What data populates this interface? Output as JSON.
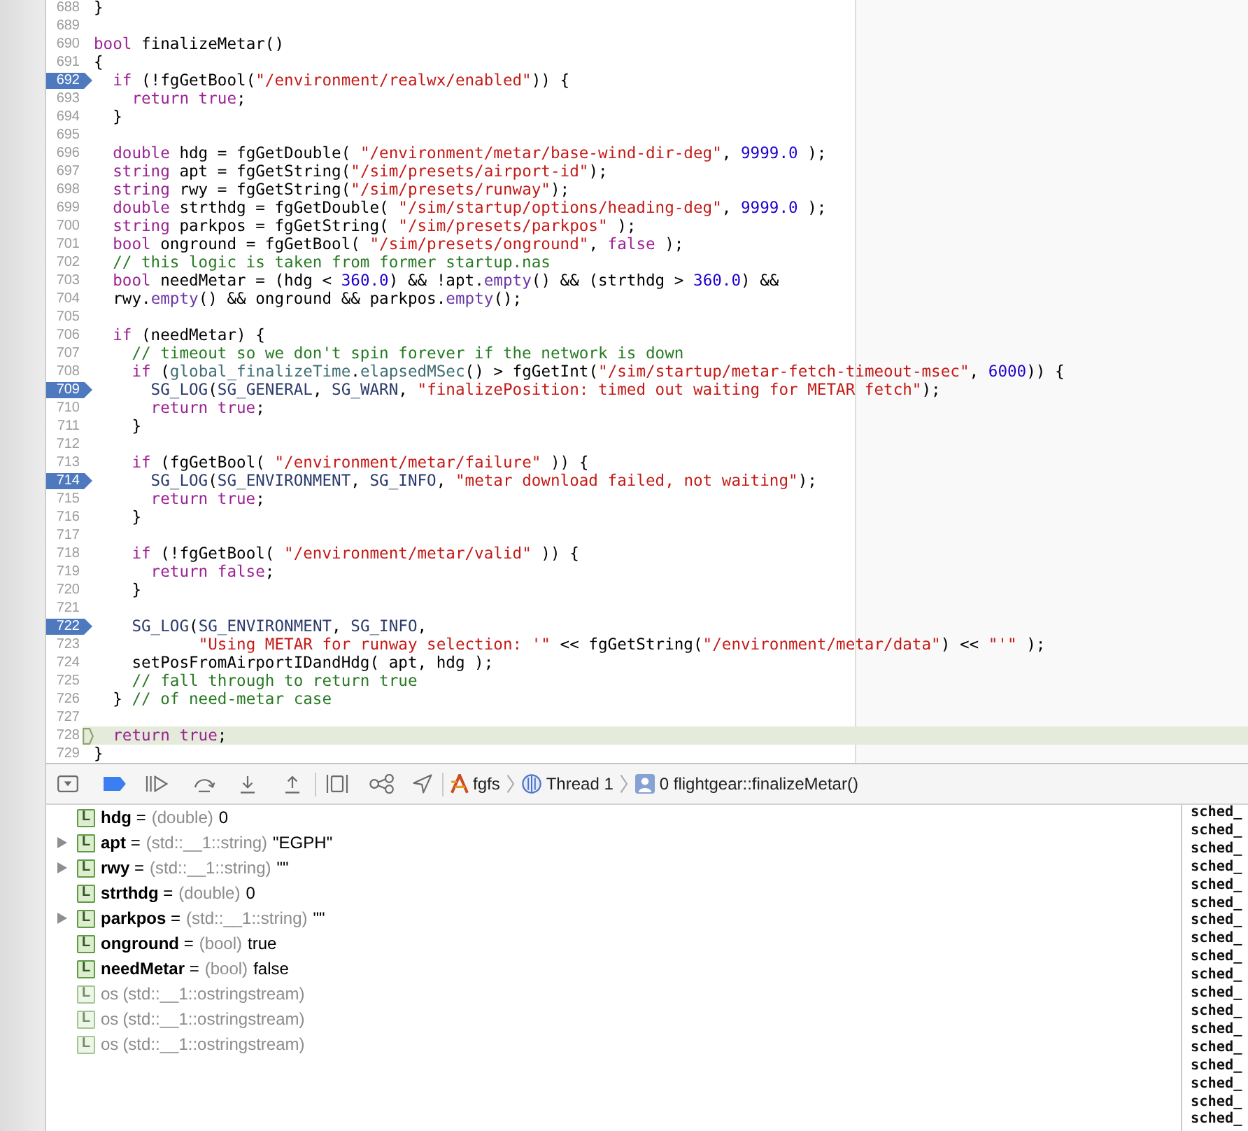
{
  "editor": {
    "lines": [
      {
        "number": "688",
        "kind": "code",
        "breakpoint": false,
        "current": false,
        "tokens": [
          {
            "kind": "plain",
            "text": "}"
          }
        ]
      },
      {
        "number": "689",
        "breakpoint": false,
        "current": false
      },
      {
        "number": "690",
        "kind": "code",
        "breakpoint": false,
        "current": false,
        "tokens": [
          {
            "kind": "keyword",
            "text": "bool"
          },
          {
            "kind": "plain",
            "text": " finalizeMetar()"
          }
        ]
      },
      {
        "number": "691",
        "kind": "code",
        "breakpoint": false,
        "current": false,
        "tokens": [
          {
            "kind": "plain",
            "text": "{"
          }
        ],
        "children": [
          {
            "number": "692",
            "kind": "code",
            "breakpoint": true,
            "current": false,
            "tokens": [
              {
                "kind": "keyword",
                "text": "if"
              },
              {
                "kind": "plain",
                "text": " (!fgGetBool("
              },
              {
                "kind": "string",
                "text": "\"/environment/realwx/enabled\""
              },
              {
                "kind": "plain",
                "text": ")) {"
              }
            ],
            "children": [
              {
                "number": "693",
                "kind": "code",
                "breakpoint": false,
                "current": false,
                "tokens": [
                  {
                    "kind": "keyword",
                    "text": "return true"
                  },
                  {
                    "kind": "plain",
                    "text": ";"
                  }
                ]
              }
            ]
          },
          {
            "number": "694",
            "kind": "code",
            "breakpoint": false,
            "current": false,
            "tokens": [
              {
                "kind": "plain",
                "text": "}"
              }
            ]
          },
          {
            "number": "695",
            "breakpoint": false,
            "current": false
          },
          {
            "number": "696",
            "kind": "code",
            "breakpoint": false,
            "current": false,
            "tokens": [
              {
                "kind": "keyword",
                "text": "double"
              },
              {
                "kind": "plain",
                "text": " hdg = fgGetDouble( "
              },
              {
                "kind": "string",
                "text": "\"/environment/metar/base-wind-dir-deg\""
              },
              {
                "kind": "plain",
                "text": ", "
              },
              {
                "kind": "number",
                "text": "9999.0"
              },
              {
                "kind": "plain",
                "text": " );"
              }
            ]
          },
          {
            "number": "697",
            "kind": "code",
            "breakpoint": false,
            "current": false,
            "tokens": [
              {
                "kind": "keyword",
                "text": "string"
              },
              {
                "kind": "plain",
                "text": " apt = fgGetString("
              },
              {
                "kind": "string",
                "text": "\"/sim/presets/airport-id\""
              },
              {
                "kind": "plain",
                "text": ");"
              }
            ]
          },
          {
            "number": "698",
            "kind": "code",
            "breakpoint": false,
            "current": false,
            "tokens": [
              {
                "kind": "keyword",
                "text": "string"
              },
              {
                "kind": "plain",
                "text": " rwy = fgGetString("
              },
              {
                "kind": "string",
                "text": "\"/sim/presets/runway\""
              },
              {
                "kind": "plain",
                "text": ");"
              }
            ]
          },
          {
            "number": "699",
            "kind": "code",
            "breakpoint": false,
            "current": false,
            "tokens": [
              {
                "kind": "keyword",
                "text": "double"
              },
              {
                "kind": "plain",
                "text": " strthdg = fgGetDouble( "
              },
              {
                "kind": "string",
                "text": "\"/sim/startup/options/heading-deg\""
              },
              {
                "kind": "plain",
                "text": ", "
              },
              {
                "kind": "number",
                "text": "9999.0"
              },
              {
                "kind": "plain",
                "text": " );"
              }
            ]
          },
          {
            "number": "700",
            "kind": "code",
            "breakpoint": false,
            "current": false,
            "tokens": [
              {
                "kind": "keyword",
                "text": "string"
              },
              {
                "kind": "plain",
                "text": " parkpos = fgGetString( "
              },
              {
                "kind": "string",
                "text": "\"/sim/presets/parkpos\""
              },
              {
                "kind": "plain",
                "text": " );"
              }
            ]
          },
          {
            "number": "701",
            "kind": "code",
            "breakpoint": false,
            "current": false,
            "tokens": [
              {
                "kind": "keyword",
                "text": "bool"
              },
              {
                "kind": "plain",
                "text": " onground = fgGetBool( "
              },
              {
                "kind": "string",
                "text": "\"/sim/presets/onground\""
              },
              {
                "kind": "plain",
                "text": ", "
              },
              {
                "kind": "keyword",
                "text": "false"
              },
              {
                "kind": "plain",
                "text": " );"
              }
            ]
          },
          {
            "number": "702",
            "kind": "code",
            "breakpoint": false,
            "current": false,
            "tokens": [
              {
                "kind": "comment",
                "text": "// this logic is taken from former startup.nas"
              }
            ]
          },
          {
            "number": "703",
            "kind": "code",
            "breakpoint": false,
            "current": false,
            "tokens": [
              {
                "kind": "keyword",
                "text": "bool"
              },
              {
                "kind": "plain",
                "text": " needMetar = (hdg < "
              },
              {
                "kind": "number",
                "text": "360.0"
              },
              {
                "kind": "plain",
                "text": ") && !apt."
              },
              {
                "kind": "method",
                "text": "empty"
              },
              {
                "kind": "plain",
                "text": "() && (strthdg > "
              },
              {
                "kind": "number",
                "text": "360.0"
              },
              {
                "kind": "plain",
                "text": ") &&"
              }
            ]
          },
          {
            "number": "704",
            "kind": "code",
            "breakpoint": false,
            "current": false,
            "tokens": [
              {
                "kind": "plain",
                "text": "rwy."
              },
              {
                "kind": "method",
                "text": "empty"
              },
              {
                "kind": "plain",
                "text": "() && onground && parkpos."
              },
              {
                "kind": "method",
                "text": "empty"
              },
              {
                "kind": "plain",
                "text": "();"
              }
            ]
          },
          {
            "number": "705",
            "breakpoint": false,
            "current": false
          },
          {
            "number": "706",
            "kind": "code",
            "breakpoint": false,
            "current": false,
            "tokens": [
              {
                "kind": "keyword",
                "text": "if"
              },
              {
                "kind": "plain",
                "text": " (needMetar) {"
              }
            ],
            "children": [
              {
                "number": "707",
                "kind": "code",
                "breakpoint": false,
                "current": false,
                "tokens": [
                  {
                    "kind": "comment",
                    "text": "// timeout so we don't spin forever if the network is down"
                  }
                ]
              },
              {
                "number": "708",
                "kind": "code",
                "breakpoint": false,
                "current": false,
                "tokens": [
                  {
                    "kind": "keyword",
                    "text": "if"
                  },
                  {
                    "kind": "plain",
                    "text": " ("
                  },
                  {
                    "kind": "member",
                    "text": "global_finalizeTime"
                  },
                  {
                    "kind": "plain",
                    "text": "."
                  },
                  {
                    "kind": "member",
                    "text": "elapsedMSec"
                  },
                  {
                    "kind": "plain",
                    "text": "() > fgGetInt("
                  },
                  {
                    "kind": "string",
                    "text": "\"/sim/startup/metar-fetch-timeout-msec\""
                  },
                  {
                    "kind": "plain",
                    "text": ", "
                  },
                  {
                    "kind": "number",
                    "text": "6000"
                  },
                  {
                    "kind": "plain",
                    "text": ")) {"
                  }
                ],
                "children": [
                  {
                    "number": "709",
                    "kind": "code",
                    "breakpoint": true,
                    "current": false,
                    "tokens": [
                      {
                        "kind": "macro",
                        "text": "SG_LOG"
                      },
                      {
                        "kind": "plain",
                        "text": "("
                      },
                      {
                        "kind": "macro",
                        "text": "SG_GENERAL"
                      },
                      {
                        "kind": "plain",
                        "text": ", "
                      },
                      {
                        "kind": "macro",
                        "text": "SG_WARN"
                      },
                      {
                        "kind": "plain",
                        "text": ", "
                      },
                      {
                        "kind": "string",
                        "text": "\"finalizePosition: timed out waiting for METAR fetch\""
                      },
                      {
                        "kind": "plain",
                        "text": ");"
                      }
                    ]
                  },
                  {
                    "number": "710",
                    "kind": "code",
                    "breakpoint": false,
                    "current": false,
                    "tokens": [
                      {
                        "kind": "keyword",
                        "text": "return true"
                      },
                      {
                        "kind": "plain",
                        "text": ";"
                      }
                    ]
                  }
                ]
              },
              {
                "number": "711",
                "kind": "code",
                "breakpoint": false,
                "current": false,
                "tokens": [
                  {
                    "kind": "plain",
                    "text": "}"
                  }
                ]
              },
              {
                "number": "712",
                "breakpoint": false,
                "current": false
              },
              {
                "number": "713",
                "kind": "code",
                "breakpoint": false,
                "current": false,
                "tokens": [
                  {
                    "kind": "keyword",
                    "text": "if"
                  },
                  {
                    "kind": "plain",
                    "text": " (fgGetBool( "
                  },
                  {
                    "kind": "string",
                    "text": "\"/environment/metar/failure\""
                  },
                  {
                    "kind": "plain",
                    "text": " )) {"
                  }
                ],
                "children": [
                  {
                    "number": "714",
                    "kind": "code",
                    "breakpoint": true,
                    "current": false,
                    "tokens": [
                      {
                        "kind": "macro",
                        "text": "SG_LOG"
                      },
                      {
                        "kind": "plain",
                        "text": "("
                      },
                      {
                        "kind": "macro",
                        "text": "SG_ENVIRONMENT"
                      },
                      {
                        "kind": "plain",
                        "text": ", "
                      },
                      {
                        "kind": "macro",
                        "text": "SG_INFO"
                      },
                      {
                        "kind": "plain",
                        "text": ", "
                      },
                      {
                        "kind": "string",
                        "text": "\"metar download failed, not waiting\""
                      },
                      {
                        "kind": "plain",
                        "text": ");"
                      }
                    ]
                  },
                  {
                    "number": "715",
                    "kind": "code",
                    "breakpoint": false,
                    "current": false,
                    "tokens": [
                      {
                        "kind": "keyword",
                        "text": "return true"
                      },
                      {
                        "kind": "plain",
                        "text": ";"
                      }
                    ]
                  }
                ]
              },
              {
                "number": "716",
                "kind": "code",
                "breakpoint": false,
                "current": false,
                "tokens": [
                  {
                    "kind": "plain",
                    "text": "}"
                  }
                ]
              },
              {
                "number": "717",
                "breakpoint": false,
                "current": false
              },
              {
                "number": "718",
                "kind": "code",
                "breakpoint": false,
                "current": false,
                "tokens": [
                  {
                    "kind": "keyword",
                    "text": "if"
                  },
                  {
                    "kind": "plain",
                    "text": " (!fgGetBool( "
                  },
                  {
                    "kind": "string",
                    "text": "\"/environment/metar/valid\""
                  },
                  {
                    "kind": "plain",
                    "text": " )) {"
                  }
                ],
                "children": [
                  {
                    "number": "719",
                    "kind": "code",
                    "breakpoint": false,
                    "current": false,
                    "tokens": [
                      {
                        "kind": "keyword",
                        "text": "return false"
                      },
                      {
                        "kind": "plain",
                        "text": ";"
                      }
                    ]
                  }
                ]
              },
              {
                "number": "720",
                "kind": "code",
                "breakpoint": false,
                "current": false,
                "tokens": [
                  {
                    "kind": "plain",
                    "text": "}"
                  }
                ]
              },
              {
                "number": "721",
                "breakpoint": false,
                "current": false
              },
              {
                "number": "722",
                "kind": "code",
                "breakpoint": true,
                "current": false,
                "tokens": [
                  {
                    "kind": "macro",
                    "text": "SG_LOG"
                  },
                  {
                    "kind": "plain",
                    "text": "("
                  },
                  {
                    "kind": "macro",
                    "text": "SG_ENVIRONMENT"
                  },
                  {
                    "kind": "plain",
                    "text": ", "
                  },
                  {
                    "kind": "macro",
                    "text": "SG_INFO"
                  },
                  {
                    "kind": "plain",
                    "text": ","
                  }
                ],
                "children": [
                  {
                    "number": "723",
                    "kind": "continuation",
                    "breakpoint": false,
                    "current": false,
                    "tokens": [
                      {
                        "kind": "string",
                        "text": "\"Using METAR for runway selection: '\""
                      },
                      {
                        "kind": "plain",
                        "text": " << fgGetString("
                      },
                      {
                        "kind": "string",
                        "text": "\"/environment/metar/data\""
                      },
                      {
                        "kind": "plain",
                        "text": ") << "
                      },
                      {
                        "kind": "string",
                        "text": "\"'\""
                      },
                      {
                        "kind": "plain",
                        "text": " );"
                      }
                    ]
                  }
                ]
              },
              {
                "number": "724",
                "kind": "code",
                "breakpoint": false,
                "current": false,
                "tokens": [
                  {
                    "kind": "plain",
                    "text": "setPosFromAirportIDandHdg( apt, hdg );"
                  }
                ]
              },
              {
                "number": "725",
                "kind": "code",
                "breakpoint": false,
                "current": false,
                "tokens": [
                  {
                    "kind": "comment",
                    "text": "// fall through to return true"
                  }
                ]
              }
            ]
          },
          {
            "number": "726",
            "kind": "code",
            "breakpoint": false,
            "current": false,
            "tokens": [
              {
                "kind": "plain",
                "text": "} "
              },
              {
                "kind": "comment",
                "text": "// of need-metar case"
              }
            ]
          },
          {
            "number": "727",
            "breakpoint": false,
            "current": false
          },
          {
            "number": "728",
            "kind": "code",
            "breakpoint": false,
            "current": true,
            "tokens": [
              {
                "kind": "keyword",
                "text": "return true"
              },
              {
                "kind": "plain",
                "text": ";"
              }
            ]
          }
        ]
      },
      {
        "number": "729",
        "kind": "code",
        "breakpoint": false,
        "current": false,
        "tokens": [
          {
            "kind": "plain",
            "text": "}"
          }
        ]
      }
    ]
  },
  "debug_bar": {
    "breakpoints_active": true,
    "breadcrumbs": [
      {
        "kind": "process",
        "label": "fgfs"
      },
      {
        "kind": "thread",
        "label": "Thread 1"
      },
      {
        "kind": "frame",
        "label": "0 flightgear::finalizeMetar()"
      }
    ]
  },
  "variables": [
    {
      "badge": "L",
      "expandable": false,
      "dimmed": false,
      "name": "hdg",
      "separator": "=",
      "type": "(double)",
      "value": "0"
    },
    {
      "badge": "L",
      "expandable": true,
      "dimmed": false,
      "name": "apt",
      "separator": "=",
      "type": "(std::__1::string)",
      "value": "\"EGPH\""
    },
    {
      "badge": "L",
      "expandable": true,
      "dimmed": false,
      "name": "rwy",
      "separator": "=",
      "type": "(std::__1::string)",
      "value": "\"\""
    },
    {
      "badge": "L",
      "expandable": false,
      "dimmed": false,
      "name": "strthdg",
      "separator": "=",
      "type": "(double)",
      "value": "0"
    },
    {
      "badge": "L",
      "expandable": true,
      "dimmed": false,
      "name": "parkpos",
      "separator": "=",
      "type": "(std::__1::string)",
      "value": "\"\""
    },
    {
      "badge": "L",
      "expandable": false,
      "dimmed": false,
      "name": "onground",
      "separator": "=",
      "type": "(bool)",
      "value": "true"
    },
    {
      "badge": "L",
      "expandable": false,
      "dimmed": false,
      "name": "needMetar",
      "separator": "=",
      "type": "(bool)",
      "value": "false"
    },
    {
      "badge": "L",
      "expandable": false,
      "dimmed": true,
      "name": "os",
      "type": "(std::__1::ostringstream)"
    },
    {
      "badge": "L",
      "expandable": false,
      "dimmed": true,
      "name": "os",
      "type": "(std::__1::ostringstream)"
    },
    {
      "badge": "L",
      "expandable": false,
      "dimmed": true,
      "name": "os",
      "type": "(std::__1::ostringstream)"
    }
  ],
  "console": {
    "lines": [
      "sched_",
      "sched_",
      "sched_",
      "sched_",
      "sched_",
      "sched_",
      "sched_",
      "sched_",
      "sched_",
      "sched_",
      "sched_",
      "sched_",
      "sched_",
      "sched_",
      "sched_",
      "sched_",
      "sched_",
      "sched_"
    ]
  }
}
